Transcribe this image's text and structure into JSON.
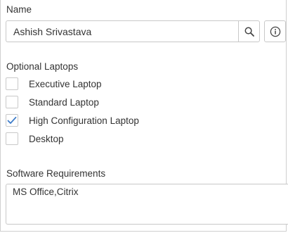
{
  "name_field": {
    "label": "Name",
    "value": "Ashish Srivastava"
  },
  "icons": {
    "search": "search-icon",
    "info": "info-icon",
    "check": "checkmark-icon"
  },
  "laptops": {
    "label": "Optional Laptops",
    "options": [
      {
        "label": "Executive Laptop",
        "checked": false
      },
      {
        "label": "Standard Laptop",
        "checked": false
      },
      {
        "label": "High Configuration Laptop",
        "checked": true
      },
      {
        "label": "Desktop",
        "checked": false
      }
    ]
  },
  "software": {
    "label": "Software Requirements",
    "value": "MS Office,Citrix"
  },
  "colors": {
    "check": "#3d7cc9",
    "border": "#c8c8c8",
    "text": "#333333"
  }
}
